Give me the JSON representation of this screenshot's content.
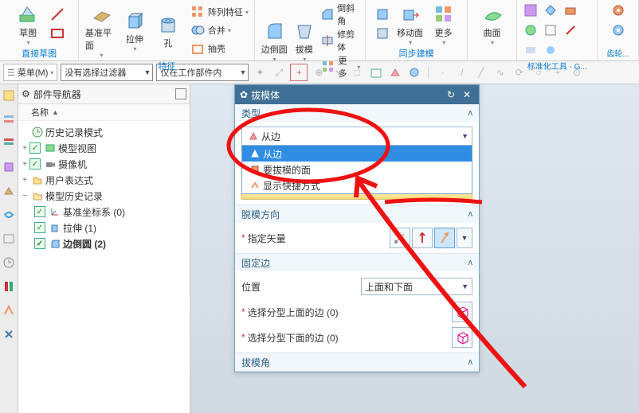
{
  "ribbon": {
    "groups": {
      "sketch": {
        "btn": "草图",
        "name": "直接草图"
      },
      "datum": {
        "btn1": "基准平面",
        "btn2": "拉伸",
        "btn3": "孔",
        "small1": "阵列特征",
        "small2": "合并",
        "small3": "抽壳",
        "name": "特征"
      },
      "edge": {
        "btn1": "边倒圆",
        "btn2": "拔模",
        "small1": "倒斜角",
        "small2": "修剪体",
        "more": "更多"
      },
      "sync": {
        "btn1": "移动面",
        "more": "更多",
        "name": "同步建模"
      },
      "surf": {
        "btn": "曲面",
        "name": "标准化工具 - G...",
        "name2": "齿轮..."
      }
    }
  },
  "toolbar": {
    "menu": "菜单(M)",
    "filter": "没有选择过滤器",
    "scope": "仅在工作部件内"
  },
  "nav": {
    "title": "部件导航器",
    "col": "名称",
    "items": {
      "history": "历史记录模式",
      "modelview": "模型视图",
      "camera": "摄像机",
      "userexpr": "用户表达式",
      "modelhistory": "模型历史记录",
      "csys": "基准坐标系 (0)",
      "extrude": "拉伸 (1)",
      "edgeblend": "边倒圆 (2)"
    }
  },
  "dialog": {
    "title": "拔模体",
    "sect_type": "类型",
    "type_value": "从边",
    "opts": {
      "o1": "从边",
      "o2": "要拔模的面",
      "o3": "显示快捷方式"
    },
    "sect_dir": "脱模方向",
    "dir_label": "指定矢量",
    "sect_fix": "固定边",
    "pos_label": "位置",
    "pos_value": "上面和下面",
    "sel_top": "选择分型上面的边 (0)",
    "sel_bot": "选择分型下面的边 (0)",
    "sect_ang": "拔模角"
  }
}
